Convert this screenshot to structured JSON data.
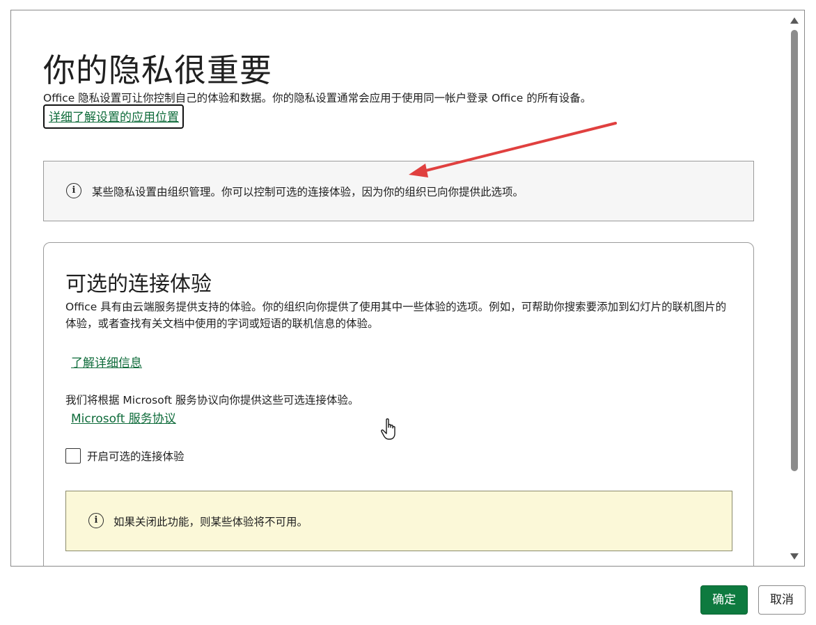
{
  "dialog": {
    "title": "你的隐私很重要",
    "intro": "Office 隐私设置可让你控制自己的体验和数据。你的隐私设置通常会应用于使用同一帐户登录 Office 的所有设备。",
    "learn_where_link": "详细了解设置的应用位置",
    "info_bar": {
      "icon": "info-icon",
      "text": "某些隐私设置由组织管理。你可以控制可选的连接体验，因为你的组织已向你提供此选项。"
    },
    "optional_experiences": {
      "title": "可选的连接体验",
      "description": "Office 具有由云端服务提供支持的体验。你的组织向你提供了使用其中一些体验的选项。例如，可帮助你搜索要添加到幻灯片的联机图片的体验，或者查找有关文档中使用的字词或短语的联机信息的体验。",
      "learn_more_link": "了解详细信息",
      "agreement_text": "我们将根据 Microsoft 服务协议向你提供这些可选连接体验。",
      "agreement_link": "Microsoft 服务协议",
      "checkbox_label": "开启可选的连接体验",
      "checkbox_checked": false,
      "warning": {
        "icon": "info-icon",
        "text": "如果关闭此功能，则某些体验将不可用。"
      }
    }
  },
  "footer": {
    "ok_label": "确定",
    "cancel_label": "取消"
  },
  "colors": {
    "link": "#0e6b3a",
    "primary_button": "#0e7a3f",
    "info_bar_bg": "#f6f6f6",
    "warning_bg": "#fbf8d8",
    "annotation_arrow": "#e0403f"
  },
  "icons": {
    "scroll_up": "triangle-up-icon",
    "scroll_down": "triangle-down-icon",
    "cursor": "hand-pointer-icon"
  }
}
